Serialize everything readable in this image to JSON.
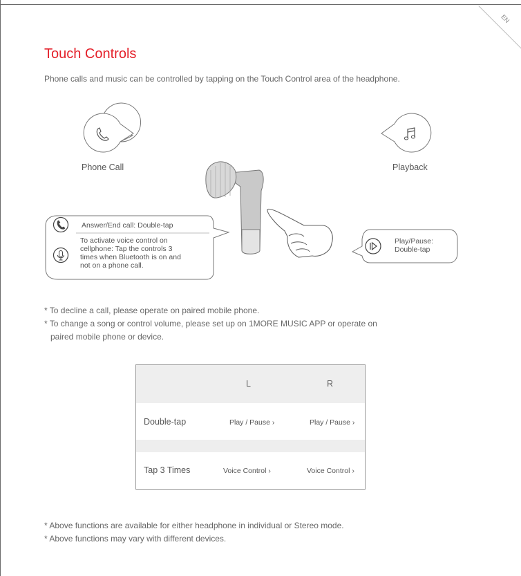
{
  "page": {
    "lang": "EN",
    "title": "Touch Controls",
    "intro": "Phone calls and music can be controlled by tapping on the Touch Control area of the headphone."
  },
  "illustration": {
    "phone_call_label": "Phone Call",
    "playback_label": "Playback",
    "answer_text": "Answer/End call: Double-tap",
    "voice_lines": [
      "To activate voice control on",
      "cellphone: Tap the controls 3",
      "times when Bluetooth is on and",
      "not on a phone call."
    ],
    "play_lines": [
      "Play/Pause:",
      "Double-tap"
    ],
    "icons": [
      "phone-icon",
      "music-note-icon",
      "microphone-icon",
      "play-pause-icon",
      "earbud-illustration",
      "hand-illustration"
    ]
  },
  "notes_top": [
    "* To decline a call, please operate on paired mobile phone.",
    "* To change a song or control volume, please set up on 1MORE MUSIC APP or operate on",
    "  paired mobile phone or device."
  ],
  "table": {
    "headers": [
      "",
      "L",
      "R"
    ],
    "rows": [
      {
        "label": "Double-tap",
        "left": "Play / Pause ›",
        "right": "Play / Pause ›"
      },
      {
        "label": "Tap 3 Times",
        "left": "Voice Control ›",
        "right": "Voice Control ›"
      }
    ]
  },
  "notes_bottom": [
    "* Above functions are available for either headphone in individual or Stereo mode.",
    "* Above functions may vary with different devices."
  ],
  "colors": {
    "accent": "#e4202a",
    "text": "#555555",
    "line": "#6a6a6a",
    "band": "#eeeeee"
  }
}
